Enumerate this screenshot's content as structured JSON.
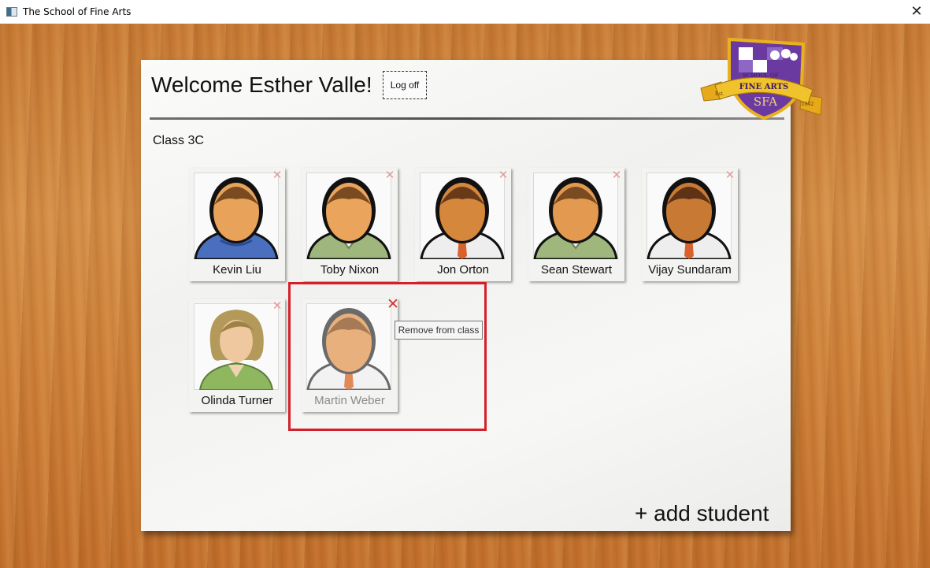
{
  "window": {
    "title": "The School of Fine Arts",
    "app_icon": "window-app-icon",
    "close_glyph": "✕"
  },
  "header": {
    "welcome": "Welcome Esther Valle!",
    "logoff_label": "Log off"
  },
  "crest": {
    "line1": "SCHOOL OF",
    "line2": "FINE ARTS",
    "initials": "SFA",
    "left_ribbon": "Est.",
    "right_ribbon": "1842",
    "colors": {
      "shield": "#5b2d8e",
      "ribbon": "#e9b21d",
      "white": "#ffffff"
    }
  },
  "class": {
    "label": "Class 3C",
    "students": [
      {
        "name": "Kevin Liu",
        "avatar": "male-avatar-blue-sweater"
      },
      {
        "name": "Toby Nixon",
        "avatar": "male-avatar-green-jacket"
      },
      {
        "name": "Jon Orton",
        "avatar": "male-avatar-white-shirt-tie"
      },
      {
        "name": "Sean Stewart",
        "avatar": "male-avatar-green-jacket"
      },
      {
        "name": "Vijay Sundaram",
        "avatar": "male-avatar-white-shirt-tie"
      },
      {
        "name": "Olinda Turner",
        "avatar": "female-avatar-green-top"
      },
      {
        "name": "Martin Weber",
        "avatar": "male-avatar-grey-disabled"
      }
    ],
    "remove_glyph": "✕"
  },
  "tooltip": {
    "text": "Remove from class"
  },
  "footer": {
    "add_student_label": "+ add student"
  },
  "colors": {
    "desk": "#cf8239",
    "paper": "#f3f3f1",
    "highlight": "#d4202a",
    "remove_active": "#d6332f",
    "remove_idle": "#e59a9a"
  }
}
